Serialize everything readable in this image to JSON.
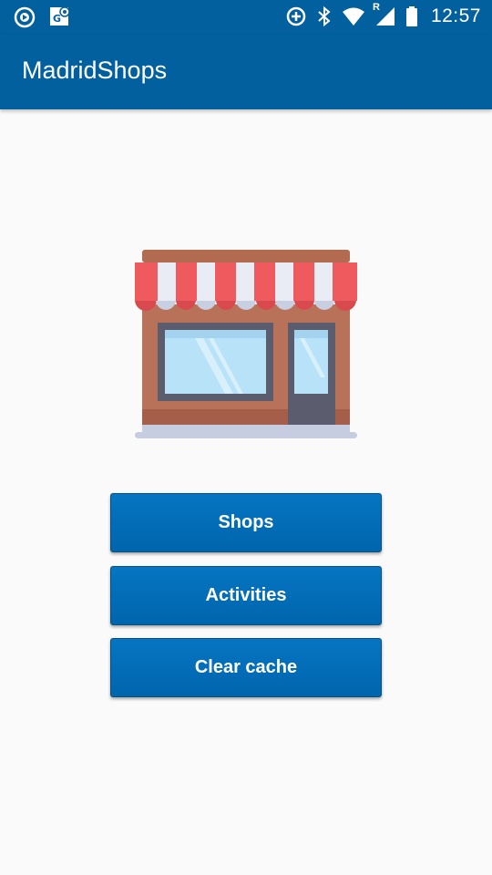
{
  "status_bar": {
    "left_icons": [
      "sync-icon",
      "map-notification-icon"
    ],
    "right_icons": [
      "data-saver-icon",
      "bluetooth-icon",
      "wifi-icon",
      "signal-icon",
      "battery-icon"
    ],
    "roaming_label": "R",
    "time": "12:57"
  },
  "app_bar": {
    "title": "MadridShops",
    "color": "#03609f"
  },
  "illustration": {
    "icon": "store-icon"
  },
  "buttons": {
    "shops": "Shops",
    "activities": "Activities",
    "clear_cache": "Clear cache"
  },
  "colors": {
    "primary": "#03609f",
    "button": "#0571ba",
    "background": "#fafafa"
  }
}
